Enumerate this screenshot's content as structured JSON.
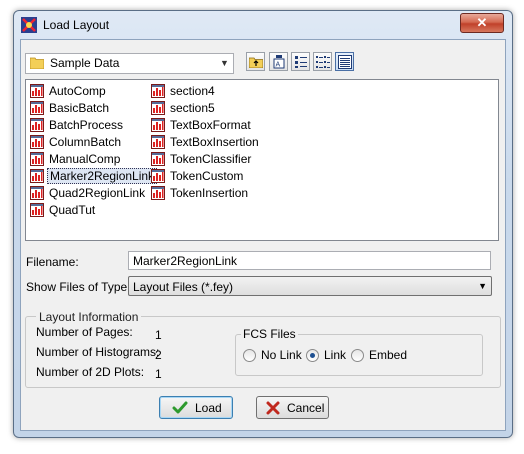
{
  "window": {
    "title": "Load Layout",
    "close_symbol": "✕",
    "app_icon": "app-logo-icon"
  },
  "folder": {
    "label": "Sample Data",
    "icon": "folder-icon"
  },
  "toolbar": {
    "buttons": [
      "up-folder-icon",
      "new-folder-icon",
      "list-view-icon",
      "details-view-icon",
      "thumbnail-view-icon"
    ]
  },
  "files": [
    "AutoComp",
    "BasicBatch",
    "BatchProcess",
    "ColumnBatch",
    "ManualComp",
    "Marker2RegionLink",
    "Quad2RegionLink",
    "QuadTut",
    "section4",
    "section5",
    "TextBoxFormat",
    "TextBoxInsertion",
    "TokenClassifier",
    "TokenCustom",
    "TokenInsertion"
  ],
  "selected_file": "Marker2RegionLink",
  "filename": {
    "label": "Filename:",
    "value": "Marker2RegionLink"
  },
  "file_type": {
    "label": "Show Files of Type",
    "value": "Layout Files (*.fey)"
  },
  "layout_info": {
    "legend": "Layout Information",
    "pages_label": "Number of Pages:",
    "pages_value": "1",
    "histograms_label": "Number of Histograms:",
    "histograms_value": "2",
    "plots_label": "Number of 2D Plots:",
    "plots_value": "1"
  },
  "fcs_files": {
    "legend": "FCS Files",
    "options": [
      "No Link",
      "Link",
      "Embed"
    ],
    "selected": "Link"
  },
  "buttons": {
    "load": "Load",
    "cancel": "Cancel"
  },
  "colors": {
    "accent": "#3c7fb1",
    "title_bar": "#c9d9ec",
    "close": "#c0412a",
    "check": "#2e9a2e",
    "cross": "#c0281e"
  }
}
